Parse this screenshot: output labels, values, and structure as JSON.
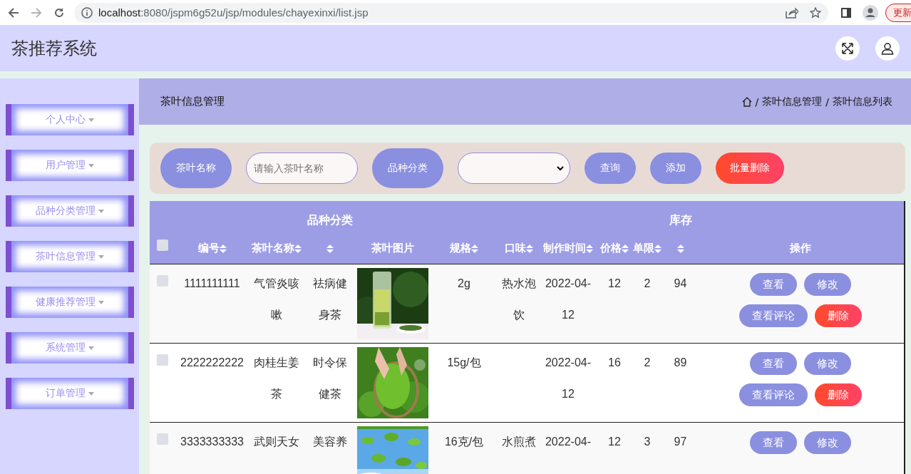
{
  "browser": {
    "url_host": "localhost",
    "url_rest": ":8080/jspm6g52u/jsp/modules/chayexinxi/list.jsp",
    "update_button": "更新"
  },
  "header": {
    "title": "茶推荐系统"
  },
  "sidebar": {
    "items": [
      {
        "label": "个人中心"
      },
      {
        "label": "用户管理"
      },
      {
        "label": "品种分类管理"
      },
      {
        "label": "茶叶信息管理"
      },
      {
        "label": "健康推荐管理"
      },
      {
        "label": "系统管理"
      },
      {
        "label": "订单管理"
      }
    ]
  },
  "page_title": "茶叶信息管理",
  "breadcrumb": {
    "separator": "/",
    "items": [
      "茶叶信息管理",
      "茶叶信息列表"
    ]
  },
  "search": {
    "name_label": "茶叶名称",
    "name_placeholder": "请输入茶叶名称",
    "category_label": "品种分类",
    "buttons": [
      {
        "label": "查询",
        "kind": "normal"
      },
      {
        "label": "添加",
        "kind": "normal"
      },
      {
        "label": "批量删除",
        "kind": "danger"
      }
    ]
  },
  "table": {
    "select_all_checked": false,
    "columns": [
      {
        "label": "编号",
        "sortable": true,
        "raised": false
      },
      {
        "label": "茶叶名称",
        "sortable": true,
        "raised": false
      },
      {
        "label": "品种分类",
        "sortable": true,
        "raised": true
      },
      {
        "label": "茶叶图片",
        "sortable": false,
        "raised": false
      },
      {
        "label": "规格",
        "sortable": true,
        "raised": false
      },
      {
        "label": "口味",
        "sortable": true,
        "raised": false
      },
      {
        "label": "制作时间",
        "sortable": true,
        "raised": false
      },
      {
        "label": "价格",
        "sortable": true,
        "raised": false
      },
      {
        "label": "单限",
        "sortable": true,
        "raised": false
      },
      {
        "label": "库存",
        "sortable": true,
        "raised": true
      },
      {
        "label": "操作",
        "sortable": false,
        "raised": false
      }
    ],
    "rows": [
      {
        "checked": false,
        "cells": [
          "1111111111",
          "气管炎咳嗽",
          "祛病健身茶",
          "",
          "2g",
          "热水泡饮",
          "2022-04-12",
          "12",
          "2",
          "94"
        ],
        "actions": [
          {
            "label": "查看",
            "kind": "normal"
          },
          {
            "label": "修改",
            "kind": "normal"
          },
          {
            "label": "查看评论",
            "kind": "normal"
          },
          {
            "label": "删除",
            "kind": "danger"
          }
        ]
      },
      {
        "checked": false,
        "cells": [
          "2222222222",
          "肉桂生姜茶",
          "时令保健茶",
          "",
          "15g/包",
          "",
          "2022-04-12",
          "16",
          "2",
          "89"
        ],
        "actions": [
          {
            "label": "查看",
            "kind": "normal"
          },
          {
            "label": "修改",
            "kind": "normal"
          },
          {
            "label": "查看评论",
            "kind": "normal"
          },
          {
            "label": "删除",
            "kind": "danger"
          }
        ]
      },
      {
        "checked": false,
        "cells": [
          "3333333333",
          "武则天女",
          "美容养",
          "",
          "16克/包",
          "水煎煮",
          "2022-04-",
          "12",
          "3",
          "97"
        ],
        "actions": [
          {
            "label": "查看",
            "kind": "normal"
          },
          {
            "label": "修改",
            "kind": "normal"
          }
        ]
      }
    ]
  }
}
